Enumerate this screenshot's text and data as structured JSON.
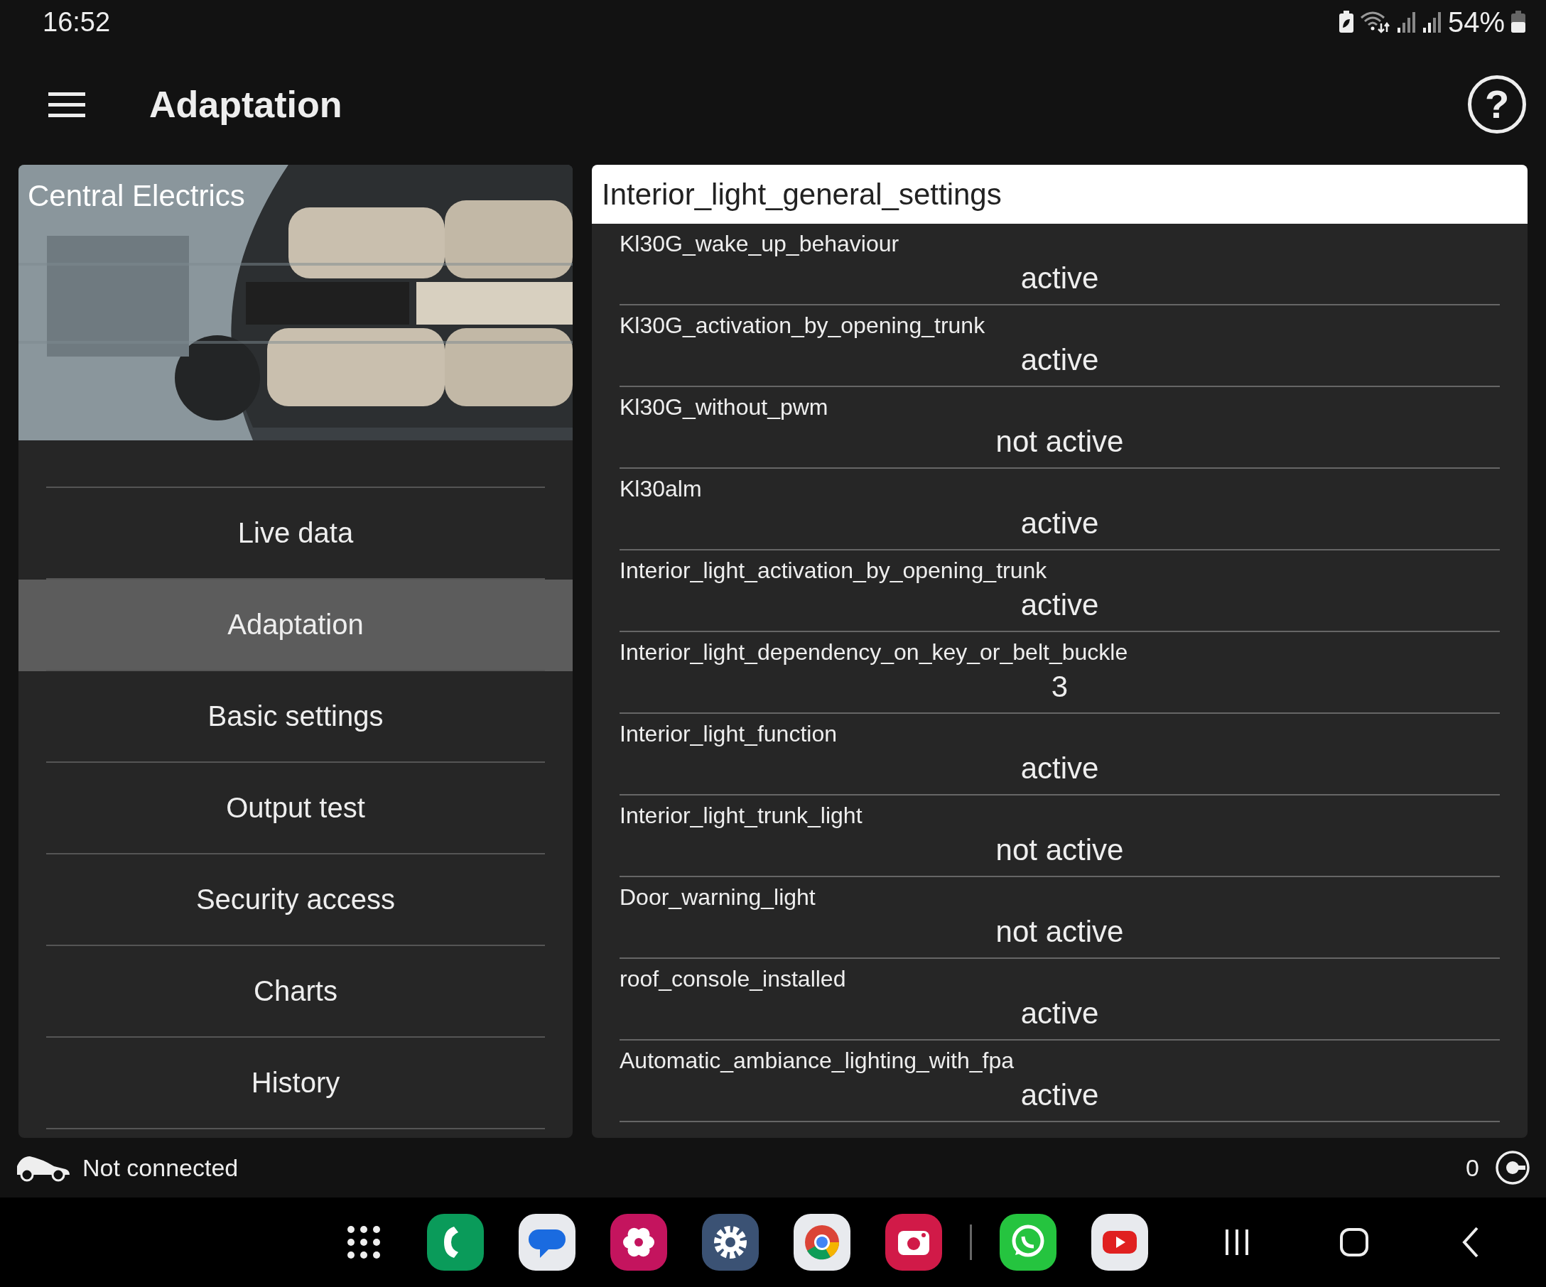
{
  "status_bar": {
    "time": "16:52",
    "battery": "54%"
  },
  "app_bar": {
    "title": "Adaptation",
    "help": "?"
  },
  "module": {
    "title": "Central Electrics"
  },
  "menu": [
    {
      "label": "Live data",
      "selected": false
    },
    {
      "label": "Adaptation",
      "selected": true
    },
    {
      "label": "Basic settings",
      "selected": false
    },
    {
      "label": "Output test",
      "selected": false
    },
    {
      "label": "Security access",
      "selected": false
    },
    {
      "label": "Charts",
      "selected": false
    },
    {
      "label": "History",
      "selected": false
    }
  ],
  "group": {
    "title": "Interior_light_general_settings"
  },
  "settings": [
    {
      "name": "Kl30G_wake_up_behaviour",
      "value": "active"
    },
    {
      "name": "Kl30G_activation_by_opening_trunk",
      "value": "active"
    },
    {
      "name": "Kl30G_without_pwm",
      "value": "not active"
    },
    {
      "name": "Kl30alm",
      "value": "active"
    },
    {
      "name": "Interior_light_activation_by_opening_trunk",
      "value": "active"
    },
    {
      "name": "Interior_light_dependency_on_key_or_belt_buckle",
      "value": "3"
    },
    {
      "name": "Interior_light_function",
      "value": "active"
    },
    {
      "name": "Interior_light_trunk_light",
      "value": "not active"
    },
    {
      "name": "Door_warning_light",
      "value": "not active"
    },
    {
      "name": "roof_console_installed",
      "value": "active"
    },
    {
      "name": "Automatic_ambiance_lighting_with_fpa",
      "value": "active"
    }
  ],
  "connection": {
    "status": "Not connected",
    "count": "0"
  }
}
